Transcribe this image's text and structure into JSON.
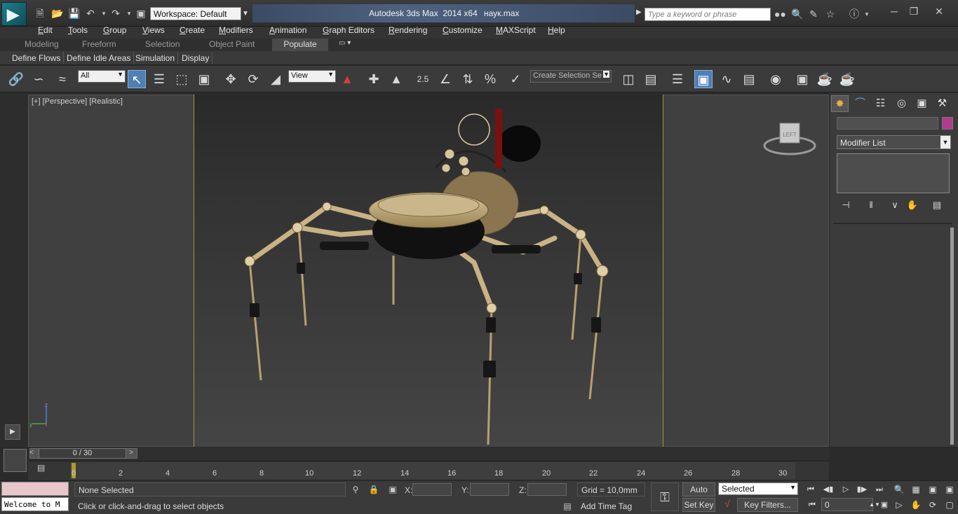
{
  "titlebar": {
    "workspace": "Workspace: Default",
    "app_title": "Autodesk 3ds Max  2014 x64",
    "file_name": "наук.max",
    "search_placeholder": "Type a keyword or phrase"
  },
  "menu": [
    "Edit",
    "Tools",
    "Group",
    "Views",
    "Create",
    "Modifiers",
    "Animation",
    "Graph Editors",
    "Rendering",
    "Customize",
    "MAXScript",
    "Help"
  ],
  "ribbon": {
    "tabs": [
      "Modeling",
      "Freeform",
      "Selection",
      "Object Paint",
      "Populate"
    ],
    "subtabs": [
      "Define Flows",
      "Define Idle Areas",
      "Simulation",
      "Display"
    ]
  },
  "toolbar": {
    "filter_select": "All",
    "ref_coord": "View",
    "snap_value": "2.5",
    "named_selection_placeholder": "Create Selection Se"
  },
  "viewport": {
    "label": "[+] [Perspective] [Realistic]",
    "viewcube_label": "LEFT",
    "axis_z": "z",
    "axis_y": "y"
  },
  "command_panel": {
    "modifier_list": "Modifier List",
    "object_color": "#b23b8d"
  },
  "timeline": {
    "frame_display": "0 / 30",
    "ticks": [
      "0",
      "2",
      "4",
      "6",
      "8",
      "10",
      "12",
      "14",
      "16",
      "18",
      "20",
      "22",
      "24",
      "26",
      "28",
      "30"
    ]
  },
  "status": {
    "selection": "None Selected",
    "prompt": "Click or click-and-drag to select objects",
    "maxscript_listener": "Welcome to M",
    "x_label": "X:",
    "y_label": "Y:",
    "z_label": "Z:",
    "grid": "Grid = 10,0mm",
    "add_time_tag": "Add Time Tag",
    "auto_key": "Auto Key",
    "set_key": "Set Key",
    "selected_mode": "Selected",
    "key_filters": "Key Filters...",
    "current_frame": "0"
  },
  "colors": {
    "accent": "#4f7fb3",
    "safe_frame": "#a8962c",
    "maxscript_pink": "#e8c7cc"
  }
}
